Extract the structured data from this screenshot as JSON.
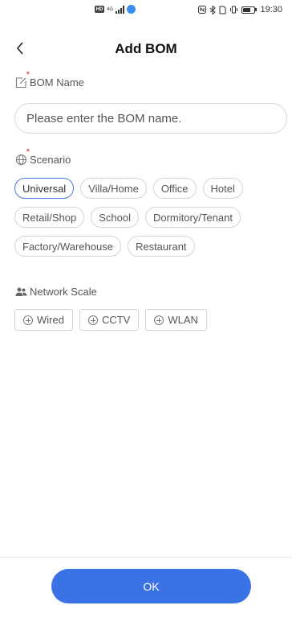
{
  "status_bar": {
    "network_badge": "HD",
    "signal_label": "4G",
    "time": "19:30",
    "wifi_color": "#3b8ef0"
  },
  "header": {
    "back_icon": "chevron-left-icon",
    "title": "Add BOM"
  },
  "bom_name": {
    "label": "BOM Name",
    "icon": "edit-icon",
    "required_mark": "*",
    "placeholder": "Please enter the BOM name.",
    "value": ""
  },
  "scenario": {
    "label": "Scenario",
    "icon": "globe-icon",
    "required_mark": "*",
    "selected": "Universal",
    "options": [
      {
        "label": "Universal"
      },
      {
        "label": "Villa/Home"
      },
      {
        "label": "Office"
      },
      {
        "label": "Hotel"
      },
      {
        "label": "Retail/Shop"
      },
      {
        "label": "School"
      },
      {
        "label": "Dormitory/Tenant"
      },
      {
        "label": "Factory/Warehouse"
      },
      {
        "label": "Restaurant"
      }
    ]
  },
  "network_scale": {
    "label": "Network Scale",
    "icon": "users-icon",
    "buttons": [
      {
        "label": "Wired",
        "icon": "plus-circle-icon"
      },
      {
        "label": "CCTV",
        "icon": "plus-circle-icon"
      },
      {
        "label": "WLAN",
        "icon": "plus-circle-icon"
      }
    ]
  },
  "footer": {
    "ok_label": "OK",
    "accent_color": "#3b72e6"
  }
}
